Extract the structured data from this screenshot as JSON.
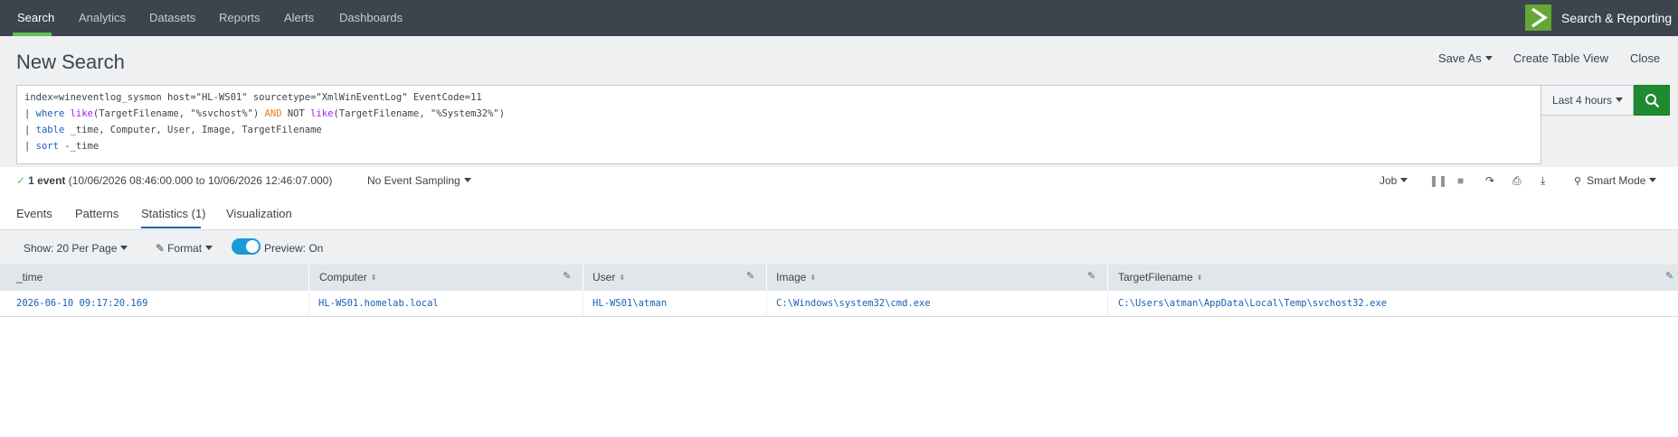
{
  "nav": {
    "items": [
      "Search",
      "Analytics",
      "Datasets",
      "Reports",
      "Alerts",
      "Dashboards"
    ],
    "active": "Search",
    "app_name": "Search & Reporting",
    "logo_icon": "splunk-chevron-logo-icon",
    "accent_color": "#5cc05c"
  },
  "page": {
    "title": "New Search",
    "actions": {
      "save_as": "Save As",
      "create_table_view": "Create Table View",
      "close": "Close"
    }
  },
  "query": {
    "lines": [
      [
        {
          "t": "index=wineventlog_sysmon host=\"HL-WS01\" sourcetype=\"XmlWinEventLog\" EventCode=11",
          "c": ""
        }
      ],
      [
        {
          "t": "| ",
          "c": ""
        },
        {
          "t": "where",
          "c": "kw-blue"
        },
        {
          "t": " ",
          "c": ""
        },
        {
          "t": "like",
          "c": "kw-fn"
        },
        {
          "t": "(TargetFilename, \"%svchost%\") ",
          "c": ""
        },
        {
          "t": "AND",
          "c": "kw-op"
        },
        {
          "t": " NOT ",
          "c": ""
        },
        {
          "t": "like",
          "c": "kw-fn"
        },
        {
          "t": "(TargetFilename, \"%System32%\")",
          "c": ""
        }
      ],
      [
        {
          "t": "| ",
          "c": ""
        },
        {
          "t": "table",
          "c": "kw-blue"
        },
        {
          "t": " _time, Computer, User, Image, TargetFilename",
          "c": ""
        }
      ],
      [
        {
          "t": "| ",
          "c": ""
        },
        {
          "t": "sort",
          "c": "kw-blue"
        },
        {
          "t": " -_time",
          "c": ""
        }
      ]
    ],
    "time_range": "Last 4 hours",
    "search_icon": "magnifier-icon",
    "search_button_color": "#1f8a30"
  },
  "status": {
    "count": "1 event",
    "range": "(10/06/2026 08:46:00.000 to 10/06/2026 12:46:07.000)",
    "sampling": "No Event Sampling",
    "job": "Job",
    "mode": "Smart Mode"
  },
  "tabs": [
    "Events",
    "Patterns",
    "Statistics (1)",
    "Visualization"
  ],
  "active_tab": "Statistics (1)",
  "toolbar": {
    "per_page": "Show: 20 Per Page",
    "format": "Format",
    "preview": "Preview: On",
    "preview_on": true
  },
  "table": {
    "columns": [
      "_time",
      "Computer",
      "User",
      "Image",
      "TargetFilename"
    ],
    "rows": [
      [
        "2026-06-10 09:17:20.169",
        "HL-WS01.homelab.local",
        "HL-WS01\\atman",
        "C:\\Windows\\system32\\cmd.exe",
        "C:\\Users\\atman\\AppData\\Local\\Temp\\svchost32.exe"
      ]
    ]
  }
}
